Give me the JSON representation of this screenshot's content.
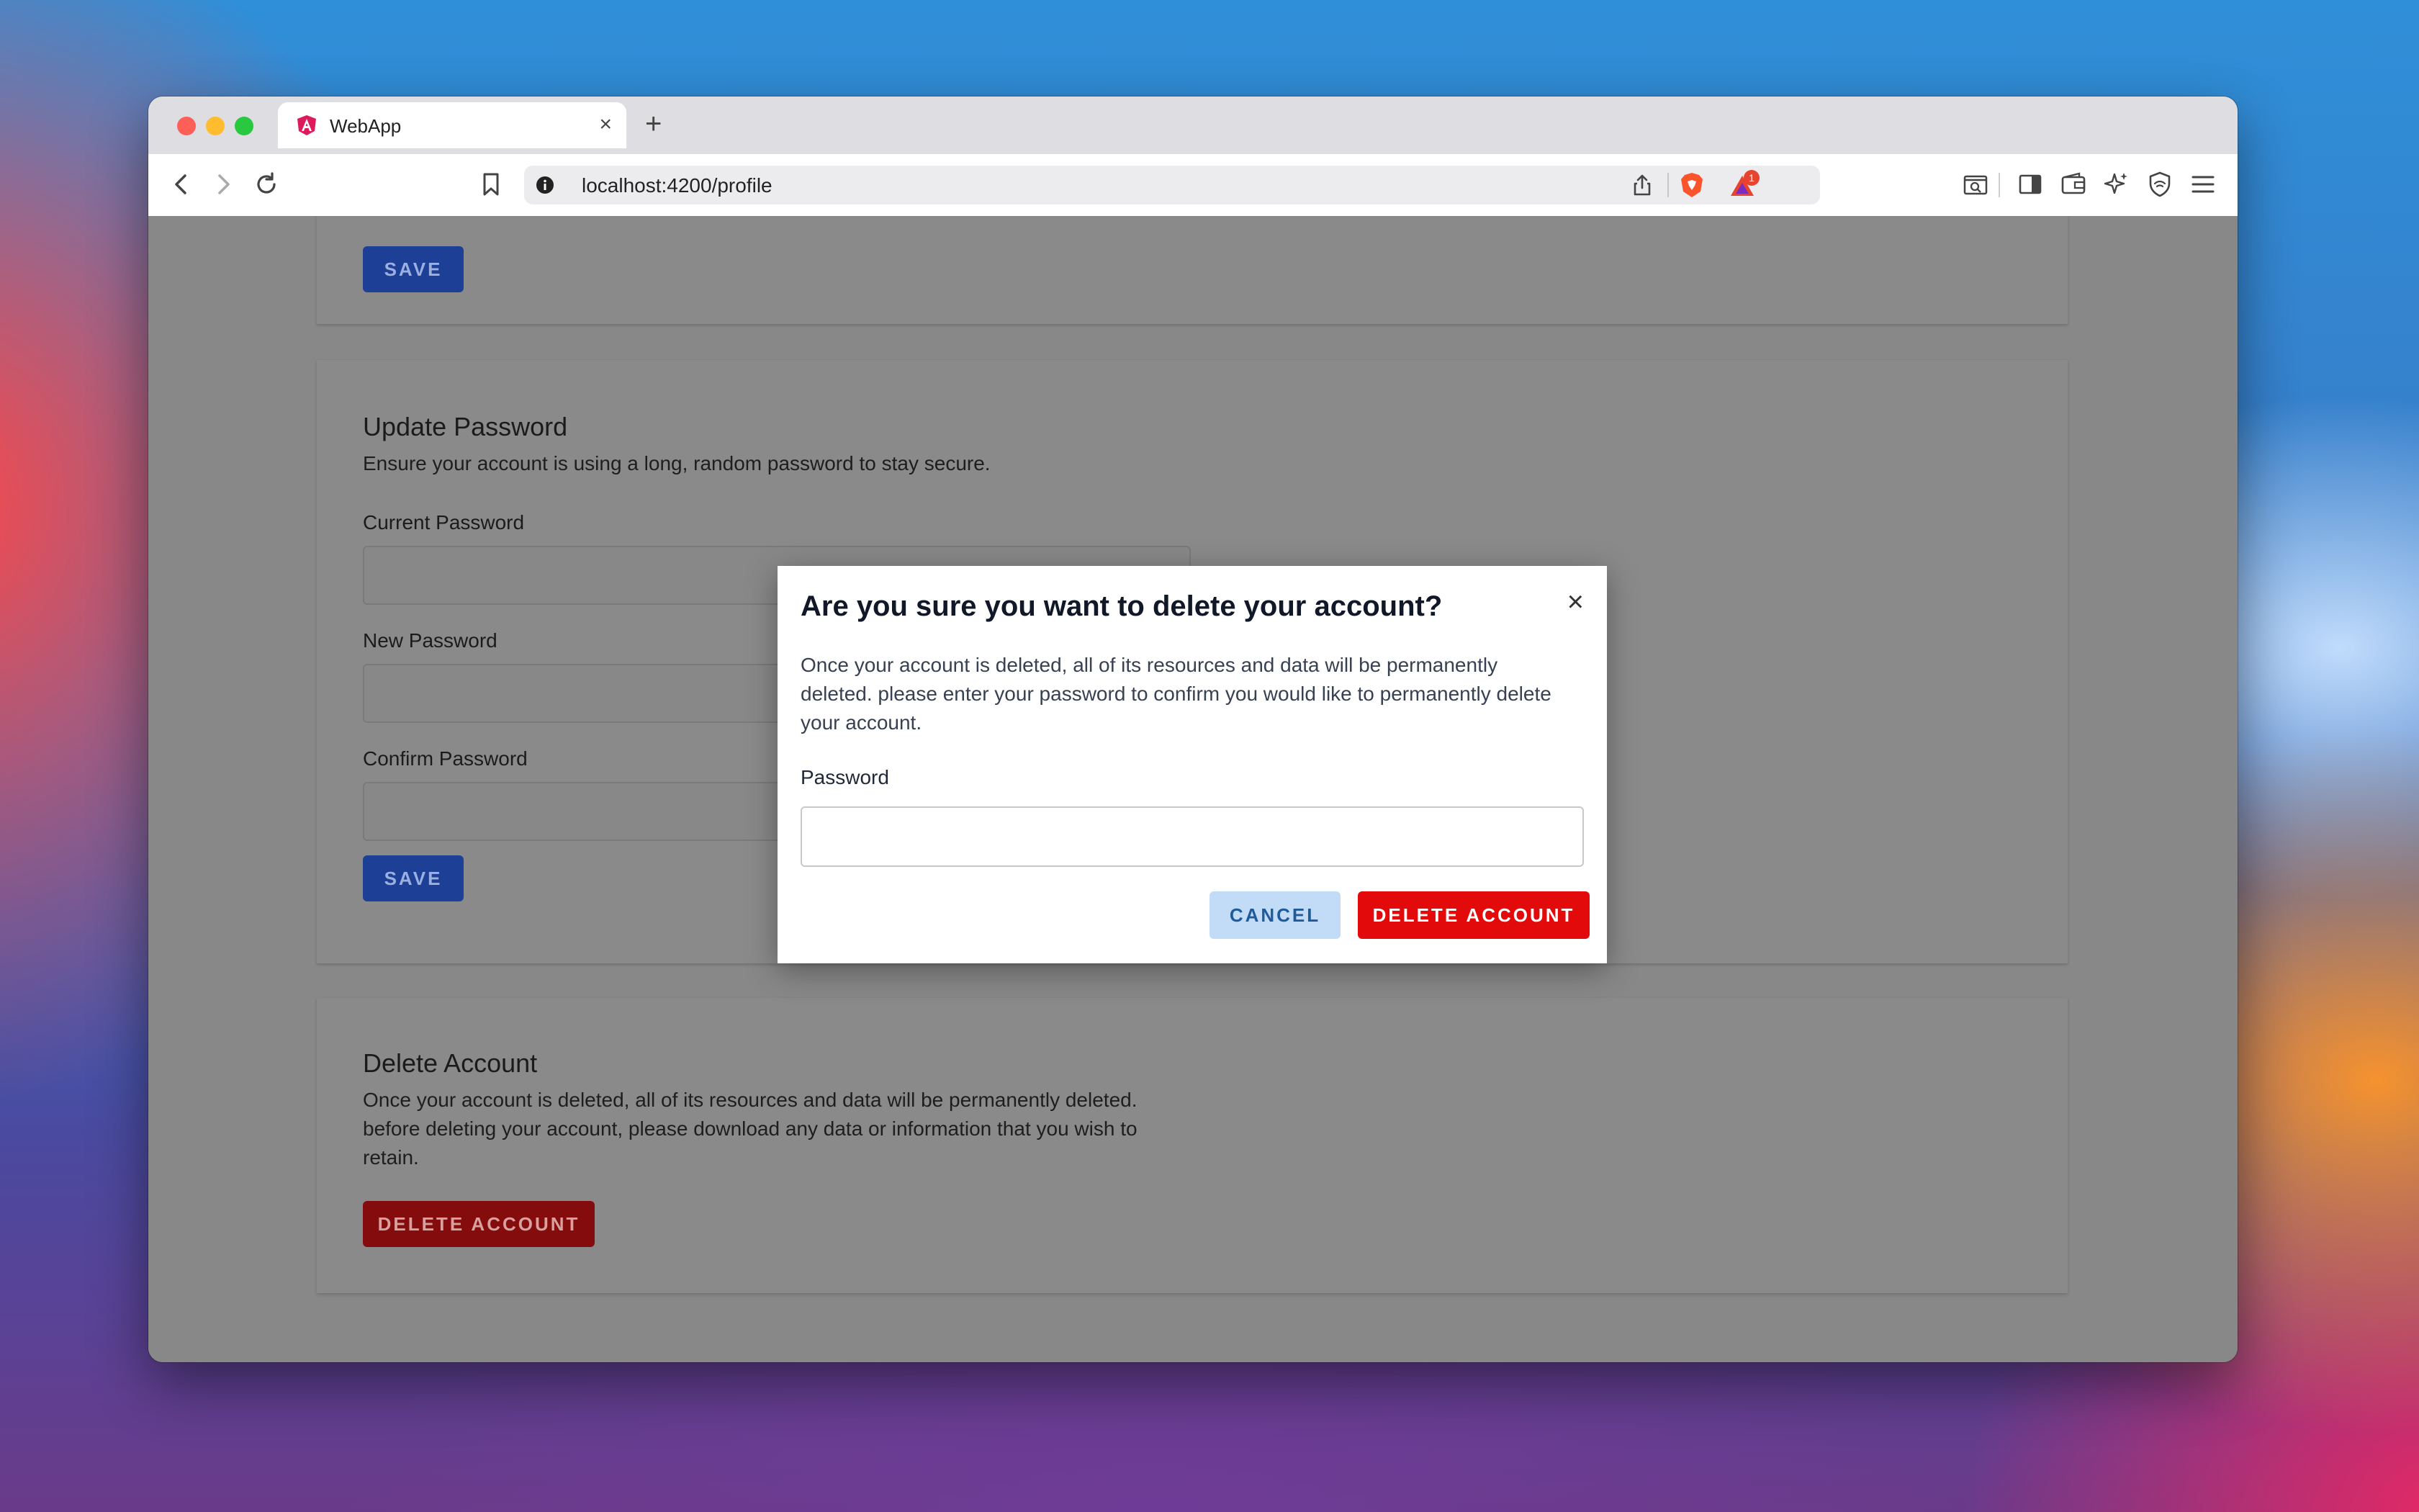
{
  "browser": {
    "tab_title": "WebApp",
    "tab_close": "×",
    "new_tab": "+",
    "url": "localhost:4200/profile",
    "notification_count": "1"
  },
  "page": {
    "profile_card": {
      "save_label": "SAVE"
    },
    "update_password": {
      "title": "Update Password",
      "description": "Ensure your account is using a long, random password to stay secure.",
      "current_password_label": "Current Password",
      "new_password_label": "New Password",
      "confirm_password_label": "Confirm Password",
      "save_label": "SAVE"
    },
    "delete_account": {
      "title": "Delete Account",
      "description": "Once your account is deleted, all of its resources and data will be permanently deleted. before deleting your account, please download any data or information that you wish to retain.",
      "button_label": "DELETE ACCOUNT"
    }
  },
  "modal": {
    "title": "Are you sure you want to delete your account?",
    "close": "×",
    "body": "Once your account is deleted, all of its resources and data will be permanently deleted. please enter your password to confirm you would like to permanently delete your account.",
    "password_label": "Password",
    "password_value": "",
    "cancel_label": "CANCEL",
    "delete_label": "DELETE ACCOUNT"
  },
  "colors": {
    "primary_blue": "#1e3f96",
    "danger_red": "#e20a0a",
    "cancel_bg": "#c2dbf6",
    "overlay_gray": "#888888"
  }
}
